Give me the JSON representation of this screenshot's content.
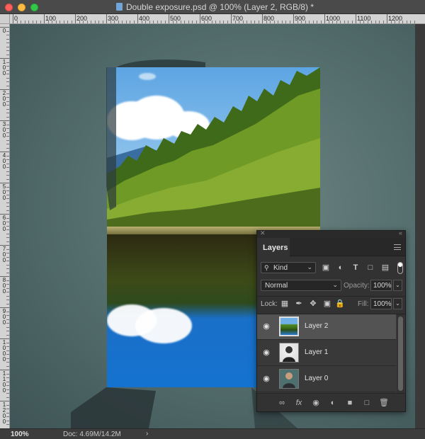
{
  "window": {
    "title": "Double exposure.psd @ 100% (Layer 2, RGB/8) *"
  },
  "rulers": {
    "top_labels": [
      "0",
      "100",
      "200",
      "300",
      "400",
      "500",
      "600",
      "700",
      "800",
      "900",
      "1000",
      "1100",
      "1200"
    ],
    "left_labels": [
      "0",
      "1\n0\n0",
      "2\n0\n0",
      "3\n0\n0",
      "4\n0\n0",
      "5\n0\n0",
      "6\n0\n0",
      "7\n0\n0",
      "8\n0\n0",
      "9\n0\n0",
      "1\n0\n0\n0",
      "1\n1\n0\n0",
      "1\n2\n0\n0"
    ]
  },
  "status_bar": {
    "zoom": "100%",
    "doc_size": "Doc: 4.69M/14.2M",
    "arrow": "›"
  },
  "layers_panel": {
    "tab_label": "Layers",
    "filter_kind": "Kind",
    "blend_mode": "Normal",
    "opacity_label": "Opacity:",
    "opacity_value": "100%",
    "lock_label": "Lock:",
    "fill_label": "Fill:",
    "fill_value": "100%",
    "layers": [
      {
        "name": "Layer 2",
        "selected": true
      },
      {
        "name": "Layer 1",
        "selected": false
      },
      {
        "name": "Layer 0",
        "selected": false
      }
    ],
    "footer_icons": [
      "link-icon",
      "fx-icon",
      "mask-icon",
      "adjustment-icon",
      "folder-icon",
      "new-layer-icon",
      "trash-icon"
    ]
  },
  "colors": {
    "canvas_bg": "#56706f",
    "panel_bg": "#323232",
    "selected_layer": "#535353"
  }
}
